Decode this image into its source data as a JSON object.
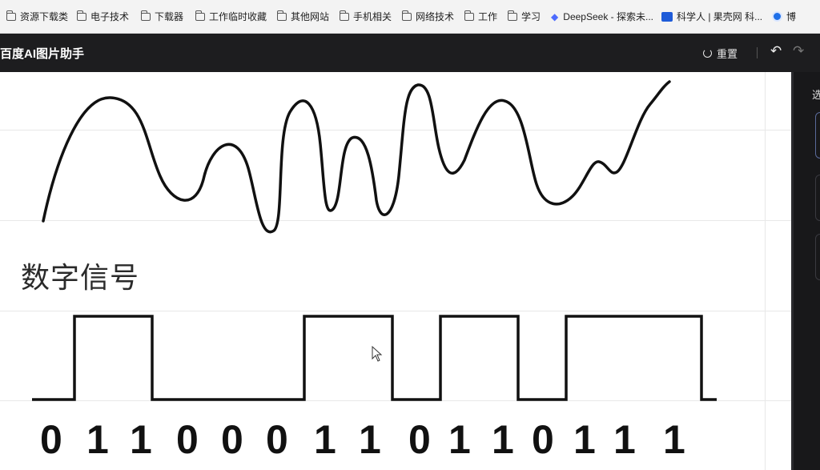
{
  "bookmarks": [
    {
      "label": "资源下载类",
      "icon": "folder-icon"
    },
    {
      "label": "电子技术",
      "icon": "folder-icon"
    },
    {
      "label": "下载器",
      "icon": "folder-icon"
    },
    {
      "label": "工作临时收藏",
      "icon": "folder-icon"
    },
    {
      "label": "其他网站",
      "icon": "folder-icon"
    },
    {
      "label": "手机相关",
      "icon": "folder-icon"
    },
    {
      "label": "网络技术",
      "icon": "folder-icon"
    },
    {
      "label": "工作",
      "icon": "folder-icon"
    },
    {
      "label": "学习",
      "icon": "folder-icon"
    },
    {
      "label": "DeepSeek - 探索未...",
      "icon": "deepseek-icon"
    },
    {
      "label": "科学人 | 果壳网 科...",
      "icon": "guokr-icon"
    },
    {
      "label": "博",
      "icon": "blog-icon"
    }
  ],
  "app": {
    "title": "百度AI图片助手",
    "reset_label": "重置"
  },
  "canvas": {
    "section_label": "数字信号",
    "digital_bits": [
      "0",
      "1",
      "1",
      "0",
      "0",
      "0",
      "1",
      "1",
      "0",
      "1",
      "1",
      "0",
      "1",
      "1",
      "1"
    ]
  },
  "side_panel": {
    "title_fragment": "选"
  }
}
